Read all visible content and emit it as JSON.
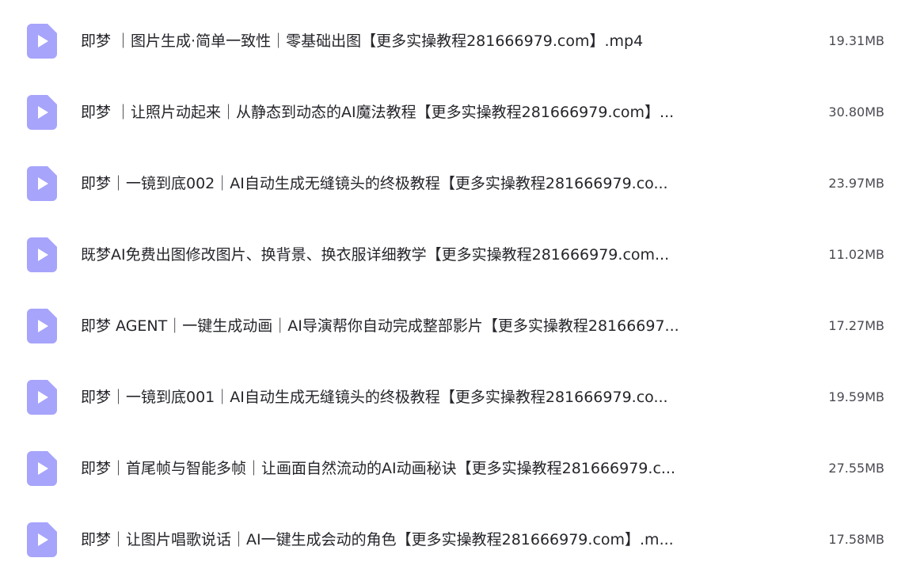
{
  "files": [
    {
      "name": "即梦 ｜图片生成·简单一致性｜零基础出图【更多实操教程281666979.com】.mp4",
      "size": "19.31MB",
      "icon": "video-file-icon"
    },
    {
      "name": "即梦 ｜让照片动起来｜从静态到动态的AI魔法教程【更多实操教程281666979.com】...",
      "size": "30.80MB",
      "icon": "video-file-icon"
    },
    {
      "name": "即梦｜一镜到底002｜AI自动生成无缝镜头的终极教程【更多实操教程281666979.co...",
      "size": "23.97MB",
      "icon": "video-file-icon"
    },
    {
      "name": "既梦AI免费出图修改图片、换背景、换衣服详细教学【更多实操教程281666979.com...",
      "size": "11.02MB",
      "icon": "video-file-icon"
    },
    {
      "name": "即梦 AGENT｜一键生成动画｜AI导演帮你自动完成整部影片【更多实操教程28166697...",
      "size": "17.27MB",
      "icon": "video-file-icon"
    },
    {
      "name": "即梦｜一镜到底001｜AI自动生成无缝镜头的终极教程【更多实操教程281666979.co...",
      "size": "19.59MB",
      "icon": "video-file-icon"
    },
    {
      "name": "即梦｜首尾帧与智能多帧｜让画面自然流动的AI动画秘诀【更多实操教程281666979.c...",
      "size": "27.55MB",
      "icon": "video-file-icon"
    },
    {
      "name": "即梦｜让图片唱歌说话｜AI一键生成会动的角色【更多实操教程281666979.com】.m...",
      "size": "17.58MB",
      "icon": "video-file-icon"
    }
  ],
  "colors": {
    "icon_fill": "#a7a4fb",
    "icon_play": "#ffffff"
  }
}
